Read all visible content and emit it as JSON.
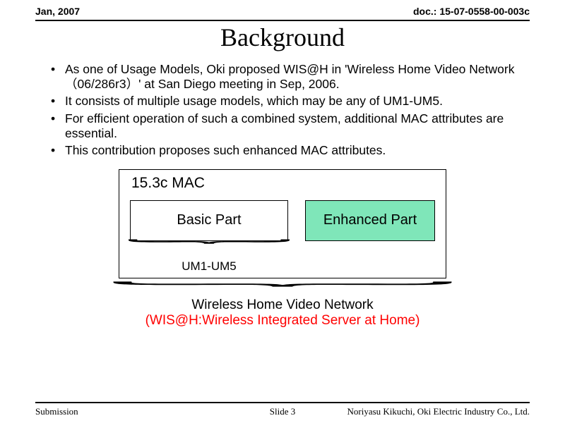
{
  "header": {
    "date": "Jan, 2007",
    "doc": "doc.: 15-07-0558-00-003c"
  },
  "title": "Background",
  "bullets": [
    "As one of Usage Models, Oki proposed WIS@H in 'Wireless Home Video Network（06/286r3）' at San Diego meeting in Sep, 2006.",
    "It consists of multiple usage models, which may be any of UM1-UM5.",
    "For efficient operation of such a combined system, additional MAC attributes are essential.",
    "This contribution proposes such enhanced MAC attributes."
  ],
  "diagram": {
    "outer_label": "15.3c MAC",
    "basic": "Basic Part",
    "enhanced": "Enhanced Part",
    "um_label": "UM1-UM5",
    "caption_main": "Wireless Home Video Network",
    "caption_sub": "(WIS@H:Wireless Integrated Server at Home)"
  },
  "footer": {
    "left": "Submission",
    "center": "Slide 3",
    "right": "Noriyasu Kikuchi, Oki Electric Industry Co., Ltd."
  }
}
